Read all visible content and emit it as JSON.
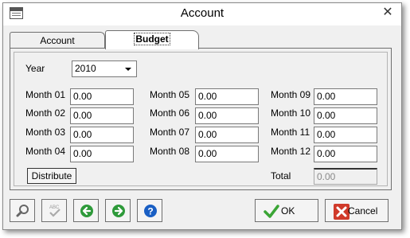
{
  "window": {
    "title": "Account"
  },
  "tabs": [
    {
      "label": "Account",
      "active": false
    },
    {
      "label": "Budget",
      "active": true
    }
  ],
  "year": {
    "label": "Year",
    "value": "2010"
  },
  "months": [
    {
      "label": "Month 01",
      "value": "0.00"
    },
    {
      "label": "Month 02",
      "value": "0.00"
    },
    {
      "label": "Month 03",
      "value": "0.00"
    },
    {
      "label": "Month 04",
      "value": "0.00"
    },
    {
      "label": "Month 05",
      "value": "0.00"
    },
    {
      "label": "Month 06",
      "value": "0.00"
    },
    {
      "label": "Month 07",
      "value": "0.00"
    },
    {
      "label": "Month 08",
      "value": "0.00"
    },
    {
      "label": "Month 09",
      "value": "0.00"
    },
    {
      "label": "Month 10",
      "value": "0.00"
    },
    {
      "label": "Month 11",
      "value": "0.00"
    },
    {
      "label": "Month 12",
      "value": "0.00"
    }
  ],
  "total": {
    "label": "Total",
    "value": "0.00"
  },
  "actions": {
    "distribute_label": "Distribute",
    "ok_label": "OK",
    "cancel_label": "Cancel"
  },
  "icons": {
    "app": "window-icon",
    "close": "close-icon",
    "search": "magnifier-icon",
    "spellcheck": "spellcheck-icon",
    "back": "arrow-left-icon",
    "forward": "arrow-right-icon",
    "help": "help-icon",
    "ok": "checkmark-icon",
    "cancel": "x-icon"
  },
  "colors": {
    "nav_green": "#2e9a3a",
    "help_blue": "#1a5fc4",
    "ok_green": "#3aa535",
    "cancel_red": "#d03a2a"
  }
}
